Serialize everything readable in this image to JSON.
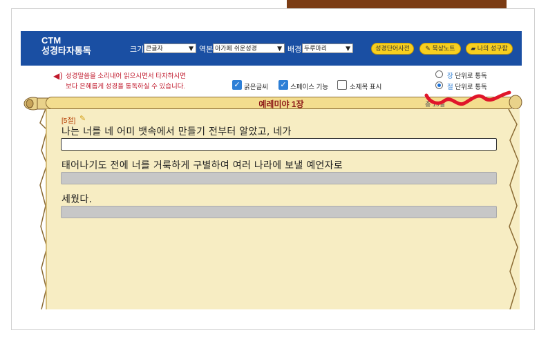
{
  "brand": {
    "line1": "CTM",
    "line2": "성경타자통독"
  },
  "header": {
    "size_label": "크기",
    "size_value": "큰글자",
    "version_label": "역본",
    "version_value": "아가페 쉬운성경",
    "bg_label": "배경",
    "bg_value": "두루마리",
    "btn_dictionary": "성경단어사전",
    "btn_meditation": "묵상노트",
    "btn_my_verses": "나의 성구함"
  },
  "info": {
    "line1": "성경말씀을 소리내어 읽으시면서 타자하시면",
    "line2": "보다 은혜롭게 성경을 통독하실 수 있습니다."
  },
  "options": {
    "bold": "굵은글씨",
    "space": "스페이스 기능",
    "subtitle": "소제목 표시"
  },
  "mode": {
    "chapter_accent": "장",
    "chapter_rest": " 단위로 통독",
    "verse_accent": "절",
    "verse_rest": " 단위로 통독",
    "selected": "verse"
  },
  "scroll": {
    "title": "예레미야 1장",
    "chapter_info": "총 19절"
  },
  "verse": {
    "tag": "[5절]",
    "lines": [
      "나는 너를 네 어미 뱃속에서 만들기 전부터 알았고, 네가",
      "태어나기도 전에 너를 거룩하게 구별하여 여러 나라에 보낼 예언자로",
      "세웠다."
    ]
  },
  "colors": {
    "header": "#1a4fa3",
    "button": "#f7cf1f",
    "accent_red": "#c0182b",
    "scroll": "#f7edc3"
  }
}
